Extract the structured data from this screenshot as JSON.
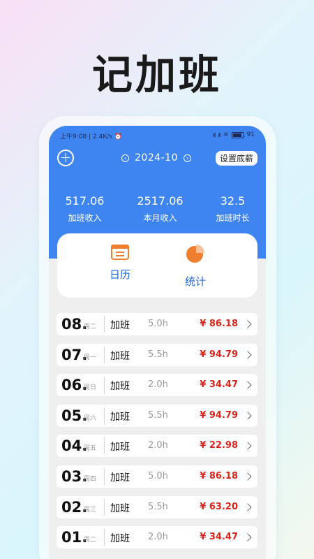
{
  "headline": "记加班",
  "status": {
    "left": "上午9:08 | 2.4K/s",
    "alarm_icon": "alarm-icon",
    "signal1": "ıll",
    "signal2": "ıll",
    "battery": "91"
  },
  "header": {
    "month": "2024-10",
    "prev_icon": "‹",
    "next_icon": "›",
    "set_button": "设置底薪",
    "plus_icon": "+"
  },
  "stats": [
    {
      "value": "517.06",
      "label": "加班收入"
    },
    {
      "value": "2517.06",
      "label": "本月收入"
    },
    {
      "value": "32.5",
      "label": "加班时长"
    }
  ],
  "tabs": {
    "calendar": "日历",
    "stats": "统计"
  },
  "colors": {
    "accent": "#3f85f1",
    "orange": "#ef7f2e",
    "amount": "#d9251c"
  },
  "records": [
    {
      "day": "08.",
      "weekday": "周二",
      "type": "加班",
      "hours": "5.0h",
      "amount": "¥ 86.18"
    },
    {
      "day": "07.",
      "weekday": "周一",
      "type": "加班",
      "hours": "5.5h",
      "amount": "¥ 94.79"
    },
    {
      "day": "06.",
      "weekday": "周日",
      "type": "加班",
      "hours": "2.0h",
      "amount": "¥ 34.47"
    },
    {
      "day": "05.",
      "weekday": "周六",
      "type": "加班",
      "hours": "5.5h",
      "amount": "¥ 94.79"
    },
    {
      "day": "04.",
      "weekday": "周五",
      "type": "加班",
      "hours": "2.0h",
      "amount": "¥ 22.98"
    },
    {
      "day": "03.",
      "weekday": "周四",
      "type": "加班",
      "hours": "5.0h",
      "amount": "¥ 86.18"
    },
    {
      "day": "02.",
      "weekday": "周三",
      "type": "加班",
      "hours": "5.5h",
      "amount": "¥ 63.20"
    },
    {
      "day": "01.",
      "weekday": "周二",
      "type": "加班",
      "hours": "2.0h",
      "amount": "¥ 34.47"
    }
  ]
}
